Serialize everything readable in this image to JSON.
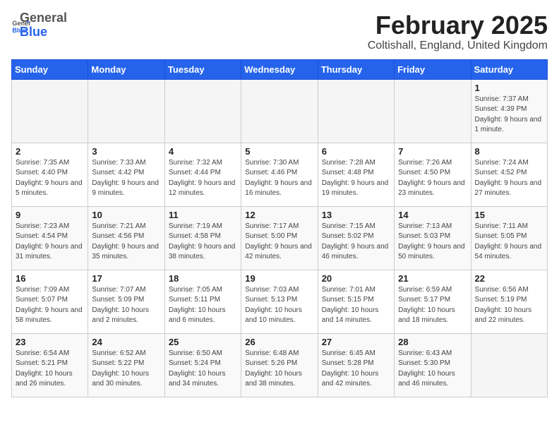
{
  "logo": {
    "general": "General",
    "blue": "Blue"
  },
  "header": {
    "title": "February 2025",
    "subtitle": "Coltishall, England, United Kingdom"
  },
  "days_of_week": [
    "Sunday",
    "Monday",
    "Tuesday",
    "Wednesday",
    "Thursday",
    "Friday",
    "Saturday"
  ],
  "weeks": [
    [
      {
        "day": "",
        "info": ""
      },
      {
        "day": "",
        "info": ""
      },
      {
        "day": "",
        "info": ""
      },
      {
        "day": "",
        "info": ""
      },
      {
        "day": "",
        "info": ""
      },
      {
        "day": "",
        "info": ""
      },
      {
        "day": "1",
        "info": "Sunrise: 7:37 AM\nSunset: 4:39 PM\nDaylight: 9 hours and 1 minute."
      }
    ],
    [
      {
        "day": "2",
        "info": "Sunrise: 7:35 AM\nSunset: 4:40 PM\nDaylight: 9 hours and 5 minutes."
      },
      {
        "day": "3",
        "info": "Sunrise: 7:33 AM\nSunset: 4:42 PM\nDaylight: 9 hours and 9 minutes."
      },
      {
        "day": "4",
        "info": "Sunrise: 7:32 AM\nSunset: 4:44 PM\nDaylight: 9 hours and 12 minutes."
      },
      {
        "day": "5",
        "info": "Sunrise: 7:30 AM\nSunset: 4:46 PM\nDaylight: 9 hours and 16 minutes."
      },
      {
        "day": "6",
        "info": "Sunrise: 7:28 AM\nSunset: 4:48 PM\nDaylight: 9 hours and 19 minutes."
      },
      {
        "day": "7",
        "info": "Sunrise: 7:26 AM\nSunset: 4:50 PM\nDaylight: 9 hours and 23 minutes."
      },
      {
        "day": "8",
        "info": "Sunrise: 7:24 AM\nSunset: 4:52 PM\nDaylight: 9 hours and 27 minutes."
      }
    ],
    [
      {
        "day": "9",
        "info": "Sunrise: 7:23 AM\nSunset: 4:54 PM\nDaylight: 9 hours and 31 minutes."
      },
      {
        "day": "10",
        "info": "Sunrise: 7:21 AM\nSunset: 4:56 PM\nDaylight: 9 hours and 35 minutes."
      },
      {
        "day": "11",
        "info": "Sunrise: 7:19 AM\nSunset: 4:58 PM\nDaylight: 9 hours and 38 minutes."
      },
      {
        "day": "12",
        "info": "Sunrise: 7:17 AM\nSunset: 5:00 PM\nDaylight: 9 hours and 42 minutes."
      },
      {
        "day": "13",
        "info": "Sunrise: 7:15 AM\nSunset: 5:02 PM\nDaylight: 9 hours and 46 minutes."
      },
      {
        "day": "14",
        "info": "Sunrise: 7:13 AM\nSunset: 5:03 PM\nDaylight: 9 hours and 50 minutes."
      },
      {
        "day": "15",
        "info": "Sunrise: 7:11 AM\nSunset: 5:05 PM\nDaylight: 9 hours and 54 minutes."
      }
    ],
    [
      {
        "day": "16",
        "info": "Sunrise: 7:09 AM\nSunset: 5:07 PM\nDaylight: 9 hours and 58 minutes."
      },
      {
        "day": "17",
        "info": "Sunrise: 7:07 AM\nSunset: 5:09 PM\nDaylight: 10 hours and 2 minutes."
      },
      {
        "day": "18",
        "info": "Sunrise: 7:05 AM\nSunset: 5:11 PM\nDaylight: 10 hours and 6 minutes."
      },
      {
        "day": "19",
        "info": "Sunrise: 7:03 AM\nSunset: 5:13 PM\nDaylight: 10 hours and 10 minutes."
      },
      {
        "day": "20",
        "info": "Sunrise: 7:01 AM\nSunset: 5:15 PM\nDaylight: 10 hours and 14 minutes."
      },
      {
        "day": "21",
        "info": "Sunrise: 6:59 AM\nSunset: 5:17 PM\nDaylight: 10 hours and 18 minutes."
      },
      {
        "day": "22",
        "info": "Sunrise: 6:56 AM\nSunset: 5:19 PM\nDaylight: 10 hours and 22 minutes."
      }
    ],
    [
      {
        "day": "23",
        "info": "Sunrise: 6:54 AM\nSunset: 5:21 PM\nDaylight: 10 hours and 26 minutes."
      },
      {
        "day": "24",
        "info": "Sunrise: 6:52 AM\nSunset: 5:22 PM\nDaylight: 10 hours and 30 minutes."
      },
      {
        "day": "25",
        "info": "Sunrise: 6:50 AM\nSunset: 5:24 PM\nDaylight: 10 hours and 34 minutes."
      },
      {
        "day": "26",
        "info": "Sunrise: 6:48 AM\nSunset: 5:26 PM\nDaylight: 10 hours and 38 minutes."
      },
      {
        "day": "27",
        "info": "Sunrise: 6:45 AM\nSunset: 5:28 PM\nDaylight: 10 hours and 42 minutes."
      },
      {
        "day": "28",
        "info": "Sunrise: 6:43 AM\nSunset: 5:30 PM\nDaylight: 10 hours and 46 minutes."
      },
      {
        "day": "",
        "info": ""
      }
    ]
  ]
}
